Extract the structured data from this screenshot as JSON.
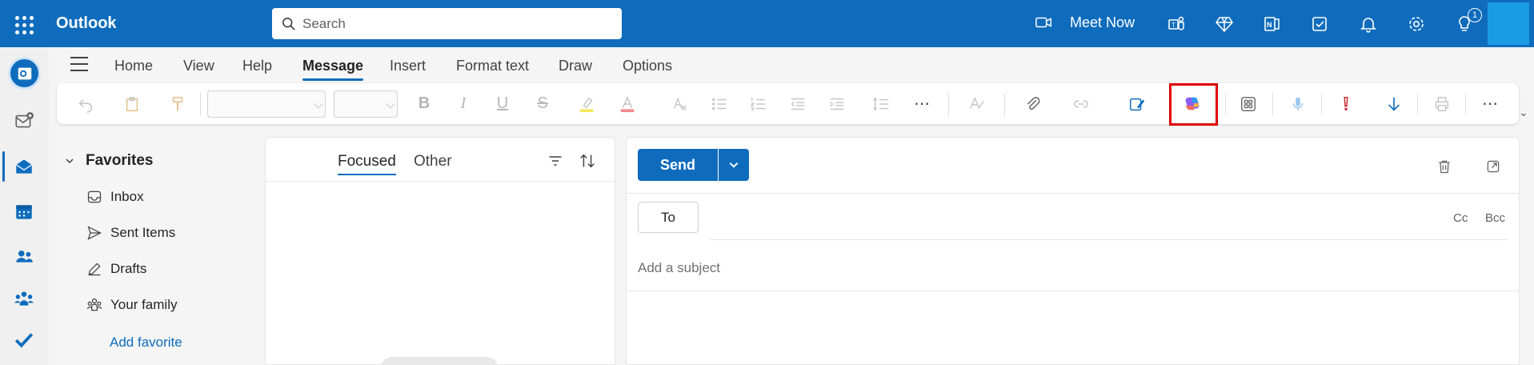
{
  "app": {
    "name": "Outlook"
  },
  "search": {
    "placeholder": "Search"
  },
  "topbar": {
    "meet_now": "Meet Now",
    "tips_badge": "1"
  },
  "ribbon": {
    "tabs": [
      {
        "label": "Home"
      },
      {
        "label": "View"
      },
      {
        "label": "Help"
      },
      {
        "label": "Message",
        "active": true
      },
      {
        "label": "Insert"
      },
      {
        "label": "Format text"
      },
      {
        "label": "Draw"
      },
      {
        "label": "Options"
      }
    ]
  },
  "folders": {
    "header": "Favorites",
    "items": [
      {
        "label": "Inbox",
        "icon": "inbox-icon"
      },
      {
        "label": "Sent Items",
        "icon": "send-icon"
      },
      {
        "label": "Drafts",
        "icon": "pencil-icon"
      },
      {
        "label": "Your family",
        "icon": "people-icon"
      }
    ],
    "add_favorite": "Add favorite"
  },
  "message_list": {
    "tabs": [
      "Focused",
      "Other"
    ],
    "active_tab": "Focused"
  },
  "compose": {
    "send": "Send",
    "to": "To",
    "cc": "Cc",
    "bcc": "Bcc",
    "subject_placeholder": "Add a subject"
  },
  "colors": {
    "brand": "#0f6cbd",
    "highlight_box": "#e00000"
  }
}
